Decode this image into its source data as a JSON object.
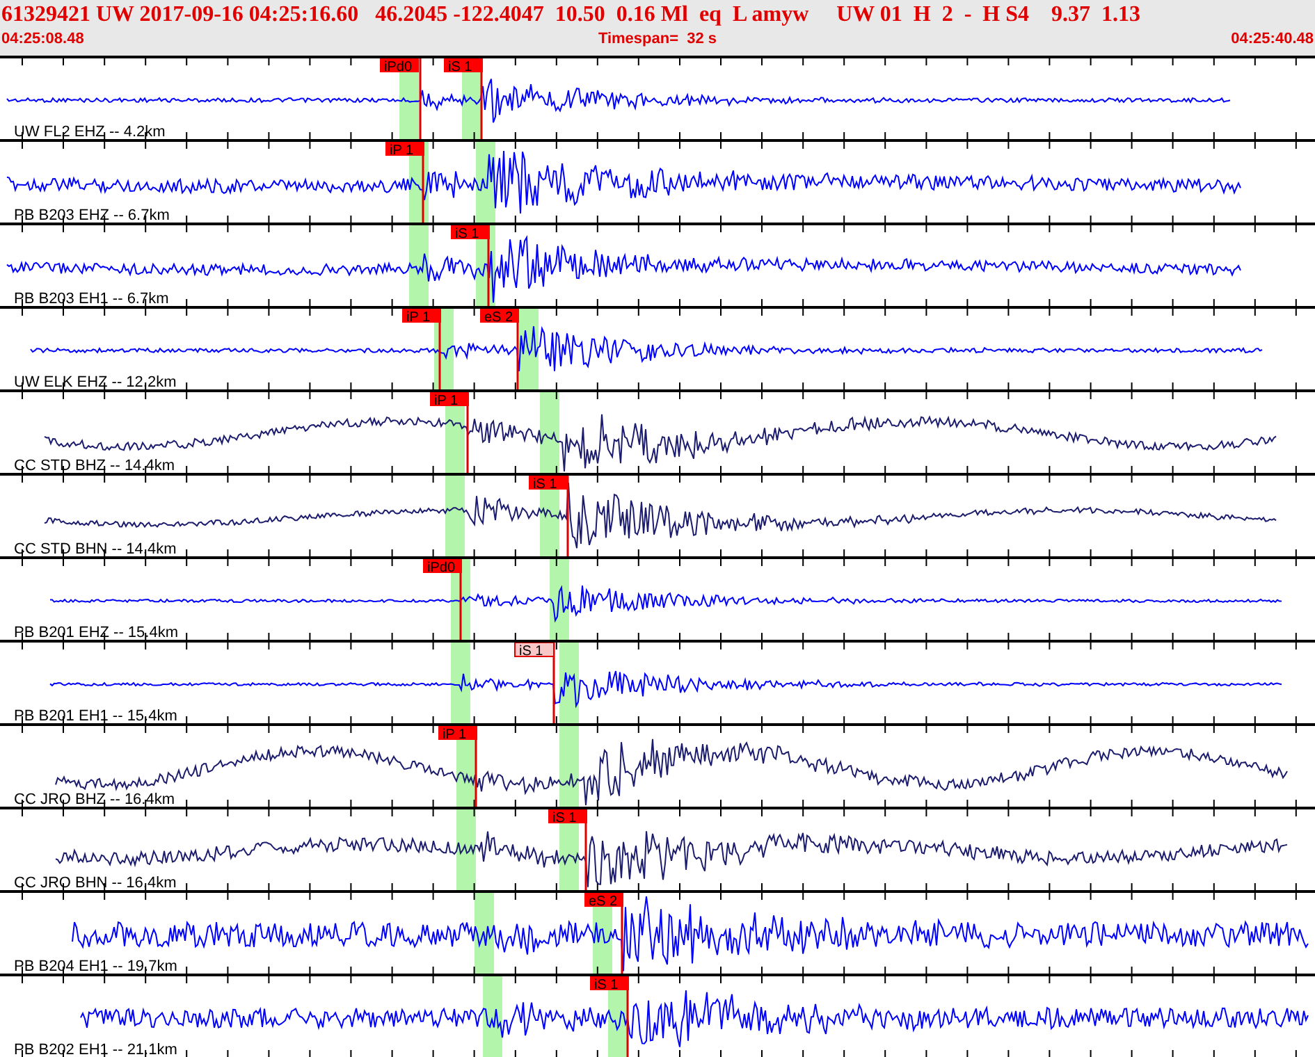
{
  "header": {
    "event_summary": "61329421 UW 2017-09-16 04:25:16.60   46.2045 -122.4047  10.50  0.16 Ml  eq  L amyw     UW 01  H  2  -  H S4    9.37  1.13",
    "start_time": "04:25:08.48",
    "timespan": "Timespan=  32 s",
    "end_time": "04:25:40.48"
  },
  "traces": [
    {
      "label": "UW FL2 EHZ -- 4.2km",
      "color": "#0000ff",
      "picks": [
        {
          "label": "iPd0",
          "selected": false
        },
        {
          "label": "iS 1",
          "selected": false
        }
      ]
    },
    {
      "label": "PB B203 EHZ -- 6.7km",
      "color": "#0000ff",
      "picks": [
        {
          "label": "iP 1",
          "selected": false
        }
      ]
    },
    {
      "label": "PB B203 EH1 -- 6.7km",
      "color": "#0000ff",
      "picks": [
        {
          "label": "iS 1",
          "selected": false
        }
      ]
    },
    {
      "label": "UW ELK EHZ -- 12.2km",
      "color": "#0000ff",
      "picks": [
        {
          "label": "iP 1",
          "selected": false
        },
        {
          "label": "eS 2",
          "selected": false
        }
      ]
    },
    {
      "label": "CC STD BHZ -- 14.4km",
      "color": "#1c1c6e",
      "picks": [
        {
          "label": "iP 1",
          "selected": false
        }
      ]
    },
    {
      "label": "CC STD BHN -- 14.4km",
      "color": "#1c1c6e",
      "picks": [
        {
          "label": "iS 1",
          "selected": false
        }
      ]
    },
    {
      "label": "PB B201 EHZ -- 15.4km",
      "color": "#0000ff",
      "picks": [
        {
          "label": "iPd0",
          "selected": false
        }
      ]
    },
    {
      "label": "PB B201 EH1 -- 15.4km",
      "color": "#0000ff",
      "picks": [
        {
          "label": "iS 1",
          "selected": true
        }
      ]
    },
    {
      "label": "CC JRO BHZ -- 16.4km",
      "color": "#1c1c6e",
      "picks": [
        {
          "label": "iP 1",
          "selected": false
        }
      ]
    },
    {
      "label": "CC JRO BHN -- 16.4km",
      "color": "#1c1c6e",
      "picks": [
        {
          "label": "iS 1",
          "selected": false
        }
      ]
    },
    {
      "label": "PB B204 EH1 -- 19.7km",
      "color": "#0000ff",
      "picks": [
        {
          "label": "eS 2",
          "selected": false
        }
      ]
    },
    {
      "label": "PB B202 EH1 -- 21.1km",
      "color": "#0000ff",
      "picks": [
        {
          "label": "iS 1",
          "selected": false
        }
      ]
    }
  ]
}
